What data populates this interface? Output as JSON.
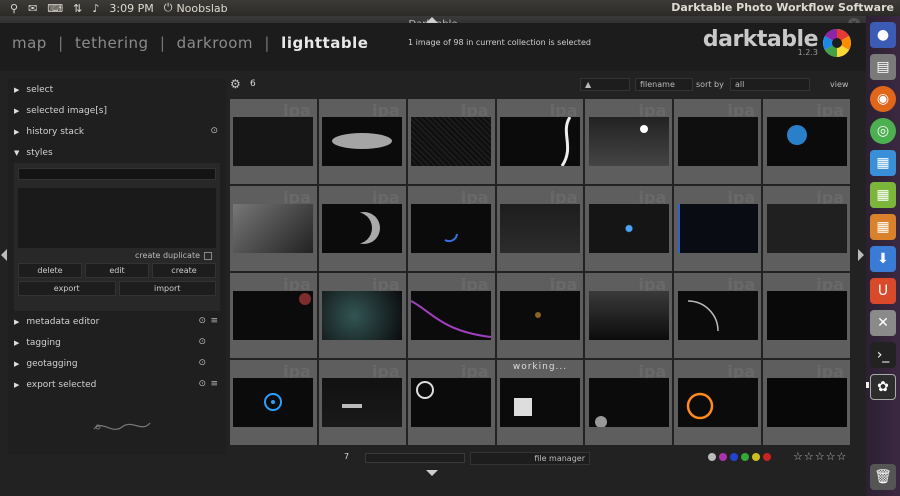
{
  "panel": {
    "username": "Noobslab",
    "time": "3:09 PM",
    "app_title": "Darktable Photo Workflow Software"
  },
  "window": {
    "title": "Darktable",
    "close": "x"
  },
  "header": {
    "views": [
      "lighttable",
      "darkroom",
      "tethering",
      "map"
    ],
    "separator": "|",
    "selection_info": "1 image of 98 in current collection is selected",
    "logo_text": "darktable",
    "logo_version": "1.2.3"
  },
  "left_panel": {
    "modules_top": [
      {
        "label": "select"
      },
      {
        "label": "selected image[s]"
      },
      {
        "label": "history stack"
      },
      {
        "label": "styles"
      }
    ],
    "styles": {
      "create_duplicate": "create duplicate",
      "buttons_row1": [
        "create",
        "edit",
        "delete"
      ],
      "buttons_row2": [
        "import",
        "export"
      ]
    },
    "modules_bottom": [
      {
        "label": "metadata editor"
      },
      {
        "label": "tagging"
      },
      {
        "label": "geotagging"
      },
      {
        "label": "export selected"
      }
    ],
    "gear_glyph": "⚙",
    "menu_glyph": "≡"
  },
  "toolbar": {
    "zoom": "6",
    "view_label": "view",
    "view_value": "all",
    "sort_label": "sort by",
    "sort_value": "filename"
  },
  "grid": {
    "working_label": "working...",
    "watermark": "ipa"
  },
  "bottom": {
    "page": "7",
    "layout": "file manager",
    "stars": "☆☆☆☆☆",
    "color_labels": [
      "#cc2222",
      "#ccbb22",
      "#33aa33",
      "#2244cc",
      "#aa33aa",
      "#bbbbbb"
    ]
  }
}
